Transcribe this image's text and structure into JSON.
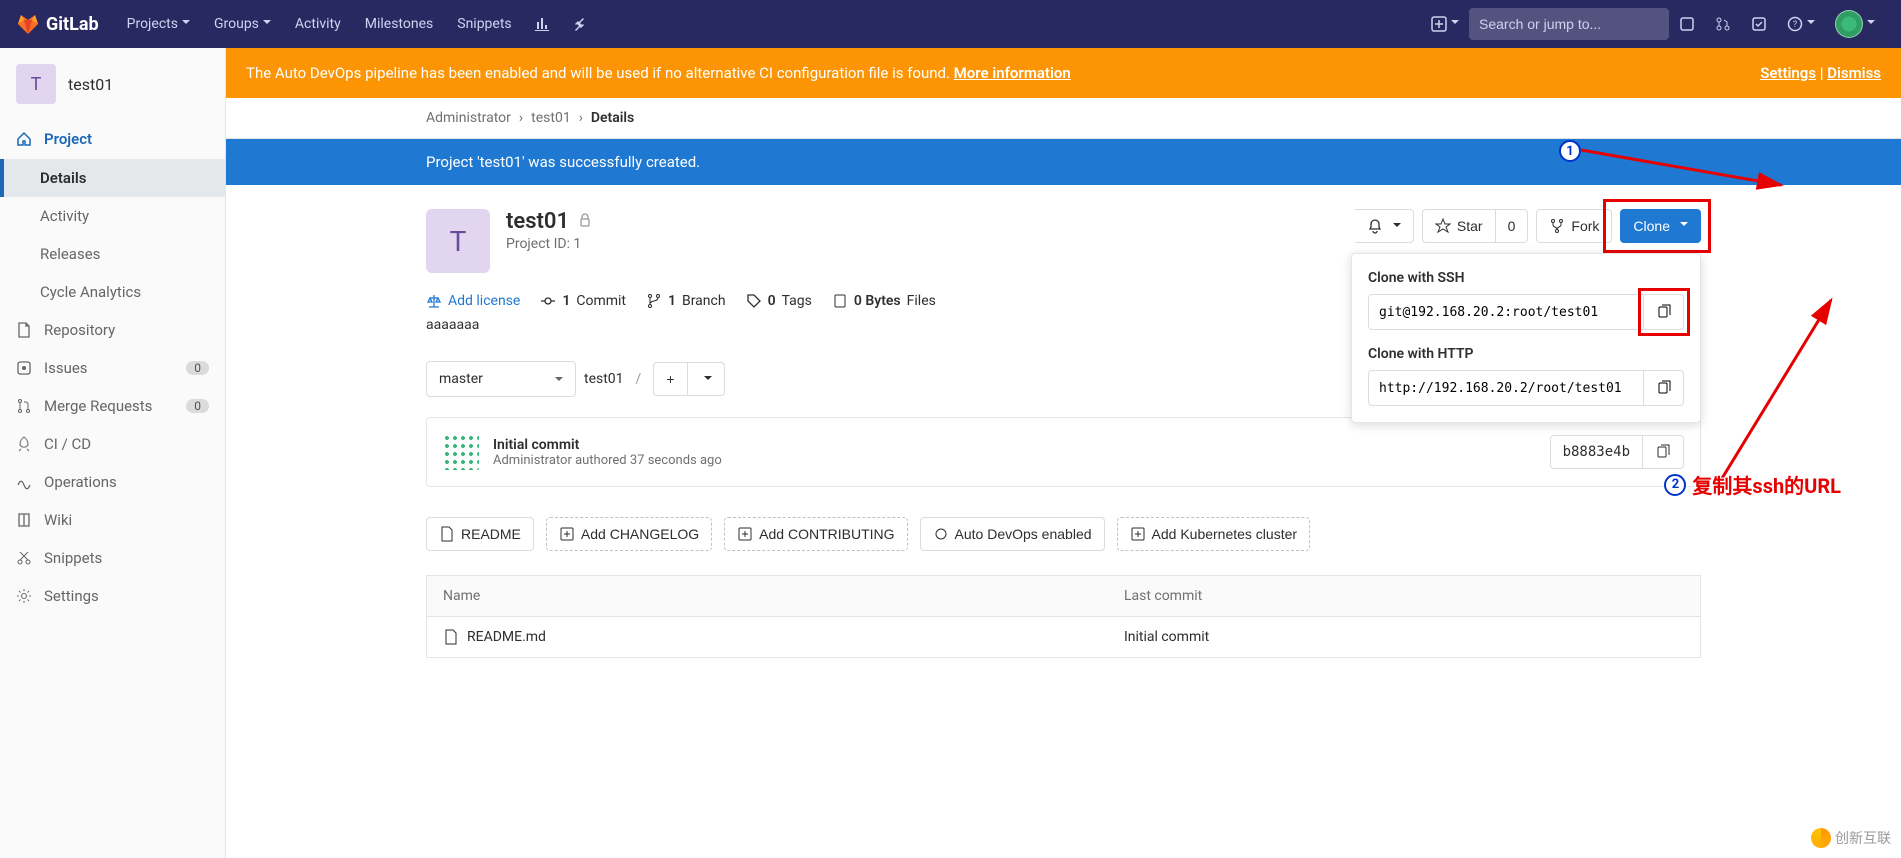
{
  "brand": "GitLab",
  "nav": {
    "projects": "Projects",
    "groups": "Groups",
    "activity": "Activity",
    "milestones": "Milestones",
    "snippets": "Snippets",
    "search_placeholder": "Search or jump to..."
  },
  "sidebar": {
    "project_letter": "T",
    "project_name": "test01",
    "items": [
      {
        "label": "Project",
        "icon": "home"
      },
      {
        "label": "Details"
      },
      {
        "label": "Activity"
      },
      {
        "label": "Releases"
      },
      {
        "label": "Cycle Analytics"
      },
      {
        "label": "Repository",
        "icon": "doc"
      },
      {
        "label": "Issues",
        "icon": "issues",
        "badge": "0"
      },
      {
        "label": "Merge Requests",
        "icon": "merge",
        "badge": "0"
      },
      {
        "label": "CI / CD",
        "icon": "rocket"
      },
      {
        "label": "Operations",
        "icon": "ops"
      },
      {
        "label": "Wiki",
        "icon": "book"
      },
      {
        "label": "Snippets",
        "icon": "snip"
      },
      {
        "label": "Settings",
        "icon": "gear"
      }
    ]
  },
  "alert_devops": {
    "text": "The Auto DevOps pipeline has been enabled and will be used if no alternative CI configuration file is found. ",
    "more": "More information",
    "settings": "Settings",
    "dismiss": "Dismiss"
  },
  "breadcrumbs": {
    "admin": "Administrator",
    "project": "test01",
    "page": "Details"
  },
  "alert_created": "Project 'test01' was successfully created.",
  "project": {
    "letter": "T",
    "name": "test01",
    "id_label": "Project ID: 1",
    "star": "Star",
    "star_count": "0",
    "fork": "Fork",
    "clone": "Clone"
  },
  "clone_panel": {
    "ssh_label": "Clone with SSH",
    "ssh_url": "git@192.168.20.2:root/test01",
    "http_label": "Clone with HTTP",
    "http_url": "http://192.168.20.2/root/test01"
  },
  "stats": {
    "add_license": "Add license",
    "commits_n": "1",
    "commits_l": "Commit",
    "branches_n": "1",
    "branches_l": "Branch",
    "tags_n": "0",
    "tags_l": "Tags",
    "bytes_n": "0 Bytes",
    "bytes_l": "Files"
  },
  "description": "aaaaaaa",
  "ref": {
    "branch": "master",
    "path": "test01"
  },
  "commit": {
    "title": "Initial commit",
    "meta": "Administrator authored 37 seconds ago",
    "sha": "b8883e4b"
  },
  "buttons": {
    "readme": "README",
    "changelog": "Add CHANGELOG",
    "contributing": "Add CONTRIBUTING",
    "devops": "Auto DevOps enabled",
    "k8s": "Add Kubernetes cluster"
  },
  "table": {
    "col_name": "Name",
    "col_commit": "Last commit",
    "row_file": "README.md",
    "row_commit": "Initial commit"
  },
  "annotations": {
    "step1": "1",
    "step2": "2",
    "step2_text": "复制其ssh的URL"
  },
  "watermark": "创新互联"
}
